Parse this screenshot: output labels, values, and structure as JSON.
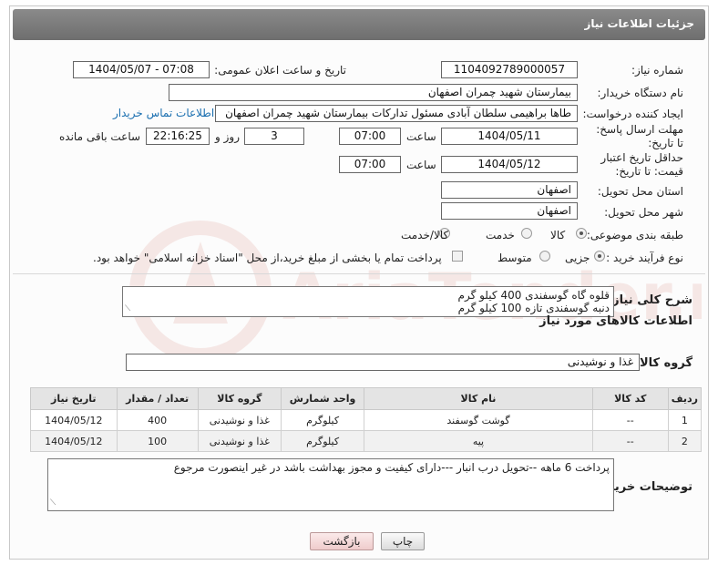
{
  "header": {
    "title": "جزئیات اطلاعات نیاز"
  },
  "fields": {
    "need_number": {
      "label": "شماره نیاز:",
      "value": "1104092789000057"
    },
    "announce_datetime": {
      "label": "تاریخ و ساعت اعلان عمومی:",
      "value": "1404/05/07 - 07:08"
    },
    "buyer_org": {
      "label": "نام دستگاه خریدار:",
      "value": "بیمارستان شهید چمران اصفهان"
    },
    "requester": {
      "label": "ایجاد کننده درخواست:",
      "value": "طاها براهیمی سلطان آبادی مسئول تدارکات  بیمارستان شهید چمران اصفهان"
    },
    "contact_link": "اطلاعات تماس خریدار",
    "reply_deadline": {
      "label": "مهلت ارسال پاسخ: تا تاریخ:",
      "date": "1404/05/11",
      "time_label": "ساعت",
      "time": "07:00",
      "days": "3",
      "days_label": "روز و",
      "remaining": "22:16:25",
      "remaining_label": "ساعت باقی مانده"
    },
    "price_validity": {
      "label": "حداقل تاریخ اعتبار قیمت: تا تاریخ:",
      "date": "1404/05/12",
      "time_label": "ساعت",
      "time": "07:00"
    },
    "delivery_province": {
      "label": "استان محل تحویل:",
      "value": "اصفهان"
    },
    "delivery_city": {
      "label": "شهر محل تحویل:",
      "value": "اصفهان"
    },
    "category": {
      "label": "طبقه بندی موضوعی:",
      "options": [
        "کالا",
        "خدمت",
        "کالا/خدمت"
      ],
      "selected": "کالا"
    },
    "purchase_type": {
      "label": "نوع فرآیند خرید :",
      "options": [
        "جزیی",
        "متوسط"
      ],
      "selected": "جزیی",
      "payment_note": "پرداخت تمام یا بخشی از مبلغ خرید،از محل \"اسناد خزانه اسلامی\" خواهد بود."
    }
  },
  "description": {
    "label": "شرح کلی نیاز:",
    "lines": [
      "قلوه گاه گوسفندی 400 کیلو گرم",
      "دنبه گوسفندی تازه 100 کیلو گرم"
    ]
  },
  "goods_section": {
    "title": "اطلاعات کالاهای مورد نیاز",
    "group_label": "گروه کالا:",
    "group_value": "غذا و نوشیدنی"
  },
  "table": {
    "headers": [
      "ردیف",
      "کد کالا",
      "نام کالا",
      "واحد شمارش",
      "گروه کالا",
      "تعداد / مقدار",
      "تاریخ نیاز"
    ],
    "rows": [
      [
        "1",
        "--",
        "گوشت گوسفند",
        "کیلوگرم",
        "غذا و نوشیدنی",
        "400",
        "1404/05/12"
      ],
      [
        "2",
        "--",
        "پیه",
        "کیلوگرم",
        "غذا و نوشیدنی",
        "100",
        "1404/05/12"
      ]
    ]
  },
  "buyer_notes": {
    "label": "توضیحات خریدار:",
    "text": "پرداخت 6 ماهه --تحویل درب انبار ---دارای کیفیت و مجوز بهداشت باشد در غیر اینصورت مرجوع"
  },
  "buttons": {
    "print": "چاپ",
    "back": "بازگشت"
  },
  "watermark": {
    "brand": "AriaTender.neT"
  },
  "colors": {
    "header_bg": "#7a7a7a",
    "link": "#1a6fb0",
    "back_button_bg": "#f6dede"
  }
}
